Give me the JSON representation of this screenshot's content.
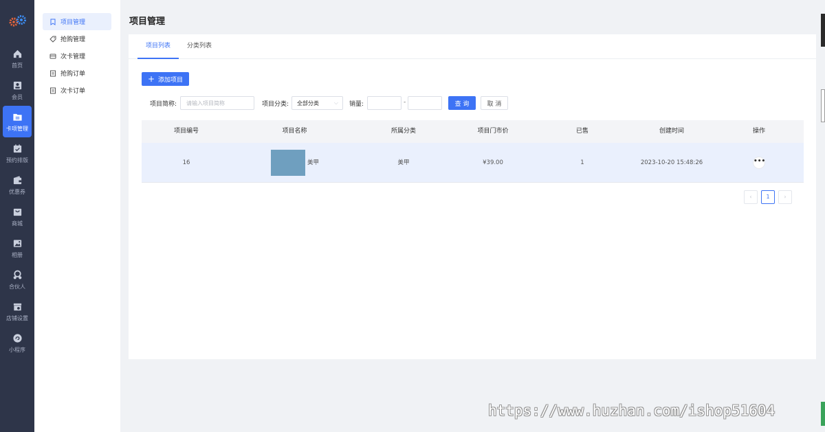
{
  "rail": {
    "items": [
      {
        "label": "首页",
        "icon": "home-icon"
      },
      {
        "label": "会员",
        "icon": "member-icon"
      },
      {
        "label": "卡项管理",
        "icon": "folder-icon"
      },
      {
        "label": "预约排版",
        "icon": "calendar-icon"
      },
      {
        "label": "优惠券",
        "icon": "wallet-icon"
      },
      {
        "label": "商城",
        "icon": "shop-bag-icon"
      },
      {
        "label": "相册",
        "icon": "album-icon"
      },
      {
        "label": "合伙人",
        "icon": "partner-icon"
      },
      {
        "label": "店铺设置",
        "icon": "store-icon"
      },
      {
        "label": "小程序",
        "icon": "miniprogram-icon"
      }
    ]
  },
  "submenu": {
    "items": [
      {
        "label": "项目管理",
        "icon": "bookmark-icon"
      },
      {
        "label": "抢购管理",
        "icon": "tag-icon"
      },
      {
        "label": "次卡管理",
        "icon": "card-icon"
      },
      {
        "label": "抢购订单",
        "icon": "order-icon"
      },
      {
        "label": "次卡订单",
        "icon": "order-icon"
      }
    ]
  },
  "page": {
    "title": "项目管理"
  },
  "tabs": [
    {
      "label": "项目列表"
    },
    {
      "label": "分类列表"
    }
  ],
  "toolbar": {
    "add_label": "添加项目"
  },
  "filters": {
    "name_label": "项目简称:",
    "name_placeholder": "请输入项目简称",
    "category_label": "项目分类:",
    "category_value": "全部分类",
    "sales_label": "销量:",
    "range_sep": "-",
    "query_label": "查 询",
    "cancel_label": "取 消"
  },
  "table": {
    "headers": [
      "项目编号",
      "项目名称",
      "所属分类",
      "项目门市价",
      "已售",
      "创建时间",
      "操作"
    ],
    "rows": [
      {
        "id": "16",
        "name": "美甲",
        "category": "美甲",
        "price": "¥39.00",
        "sold": "1",
        "created": "2023-10-20 15:48:26",
        "action": "•••"
      }
    ]
  },
  "pagination": {
    "prev": "‹",
    "current": "1",
    "next": "›"
  },
  "watermark": "https://www.huzhan.com/ishop51604",
  "colors": {
    "accent": "#3d73f5",
    "rail_bg": "#2e3549",
    "row_highlight": "#eaf0fd"
  }
}
